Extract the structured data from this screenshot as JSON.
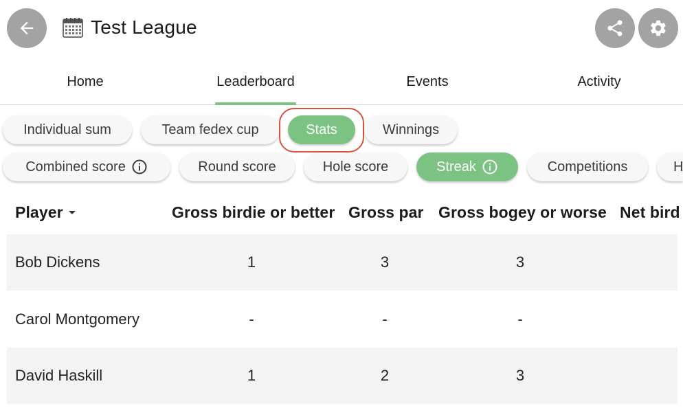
{
  "header": {
    "title": "Test League",
    "icons": {
      "back": "arrow-left-icon",
      "calendar": "calendar-icon",
      "share": "share-icon",
      "settings": "gear-icon"
    }
  },
  "tabs": [
    {
      "label": "Home",
      "active": false
    },
    {
      "label": "Leaderboard",
      "active": true
    },
    {
      "label": "Events",
      "active": false
    },
    {
      "label": "Activity",
      "active": false
    }
  ],
  "leaderboard_chips": [
    {
      "label": "Individual sum",
      "active": false
    },
    {
      "label": "Team fedex cup",
      "active": false
    },
    {
      "label": "Stats",
      "active": true
    },
    {
      "label": "Winnings",
      "active": false
    }
  ],
  "stat_chips": [
    {
      "label": "Combined score",
      "active": false,
      "info": true
    },
    {
      "label": "Round score",
      "active": false
    },
    {
      "label": "Hole score",
      "active": false
    },
    {
      "label": "Streak",
      "active": true,
      "info": true
    },
    {
      "label": "Competitions",
      "active": false
    },
    {
      "label": "H",
      "active": false
    }
  ],
  "table": {
    "columns": [
      "Player",
      "Gross birdie or better",
      "Gross par",
      "Gross bogey or worse",
      "Net bird"
    ],
    "rows": [
      {
        "player": "Bob Dickens",
        "birdie": "1",
        "par": "3",
        "bogey": "3"
      },
      {
        "player": "Carol Montgomery",
        "birdie": "-",
        "par": "-",
        "bogey": "-"
      },
      {
        "player": "David Haskill",
        "birdie": "1",
        "par": "2",
        "bogey": "3"
      }
    ]
  },
  "colors": {
    "accent": "#7cc283",
    "icon_button": "#a3a3a3",
    "highlight": "#d9533c",
    "row_shade": "#f3f3f3"
  }
}
